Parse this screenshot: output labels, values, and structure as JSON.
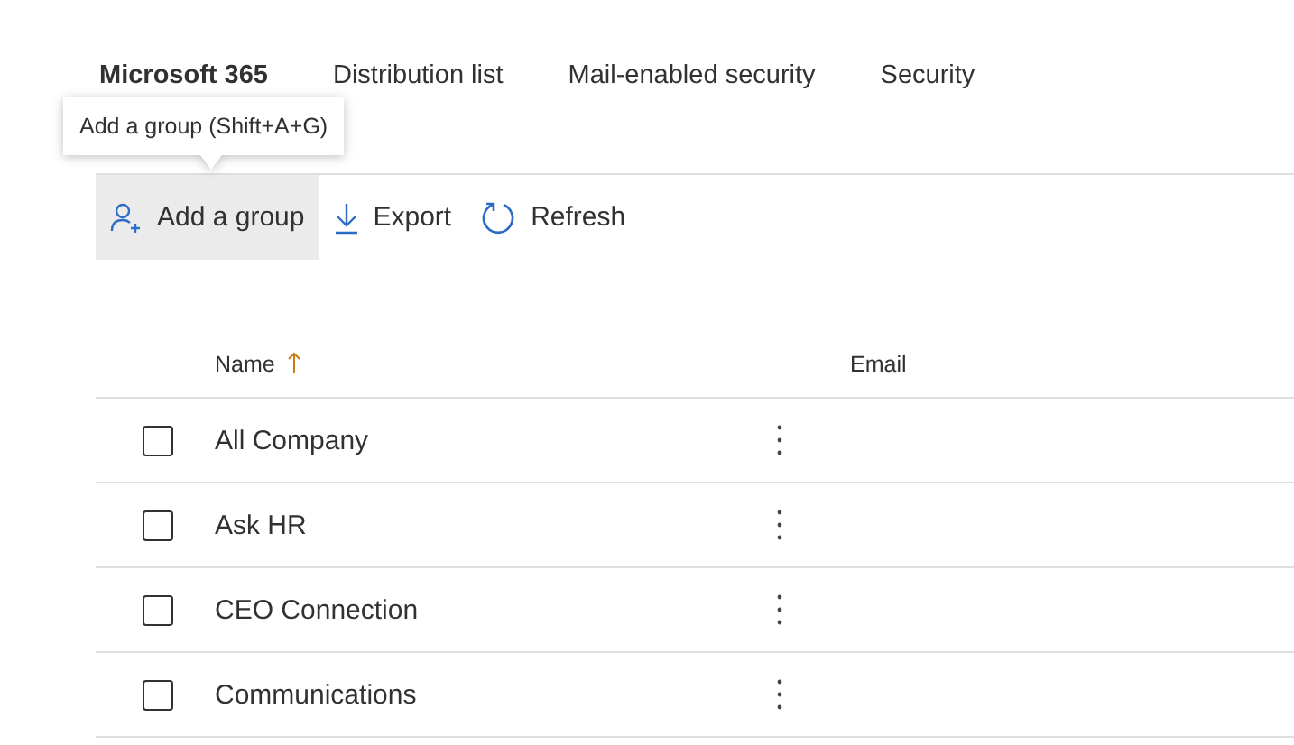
{
  "tabs": [
    {
      "label": "Microsoft 365",
      "selected": true
    },
    {
      "label": "Distribution list",
      "selected": false
    },
    {
      "label": "Mail-enabled security",
      "selected": false
    },
    {
      "label": "Security",
      "selected": false
    }
  ],
  "tooltip": {
    "text": "Add a group (Shift+A+G)"
  },
  "toolbar": [
    {
      "kind": "add",
      "label": "Add a group",
      "hovered": true
    },
    {
      "kind": "export",
      "label": "Export",
      "hovered": false
    },
    {
      "kind": "refresh",
      "label": "Refresh",
      "hovered": false
    }
  ],
  "table": {
    "columns": [
      {
        "label": "Name",
        "sorted_ascending": true
      },
      {
        "label": "Email"
      }
    ],
    "rows": [
      {
        "name": "All Company",
        "checked": false
      },
      {
        "name": "Ask HR",
        "checked": false
      },
      {
        "name": "CEO Connection",
        "checked": false
      },
      {
        "name": "Communications",
        "checked": false
      }
    ]
  }
}
